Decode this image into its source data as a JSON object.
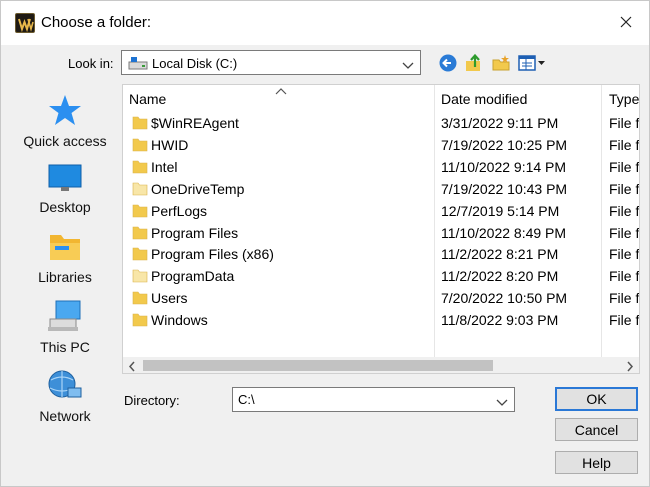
{
  "dialog": {
    "title": "Choose a folder:",
    "close_glyph": "✕"
  },
  "lookin": {
    "label": "Look in:",
    "value": "Local Disk (C:)",
    "icon": "drive-icon"
  },
  "toolbar": {
    "icons": [
      "back-icon",
      "up-folder-icon",
      "new-folder-icon",
      "view-menu-icon"
    ]
  },
  "places": [
    {
      "label": "Quick access",
      "icon": "quick-access-star-icon"
    },
    {
      "label": "Desktop",
      "icon": "desktop-icon"
    },
    {
      "label": "Libraries",
      "icon": "libraries-icon"
    },
    {
      "label": "This PC",
      "icon": "this-pc-icon"
    },
    {
      "label": "Network",
      "icon": "network-icon"
    }
  ],
  "columns": {
    "name": "Name",
    "date": "Date modified",
    "type": "Type"
  },
  "files": [
    {
      "name": "$WinREAgent",
      "date": "3/31/2022 9:11 PM",
      "type": "File folder",
      "hidden": false
    },
    {
      "name": "HWID",
      "date": "7/19/2022 10:25 PM",
      "type": "File folder",
      "hidden": false
    },
    {
      "name": "Intel",
      "date": "11/10/2022 9:14 PM",
      "type": "File folder",
      "hidden": false
    },
    {
      "name": "OneDriveTemp",
      "date": "7/19/2022 10:43 PM",
      "type": "File folder",
      "hidden": true
    },
    {
      "name": "PerfLogs",
      "date": "12/7/2019 5:14 PM",
      "type": "File folder",
      "hidden": false
    },
    {
      "name": "Program Files",
      "date": "11/10/2022 8:49 PM",
      "type": "File folder",
      "hidden": false
    },
    {
      "name": "Program Files (x86)",
      "date": "11/2/2022 8:21 PM",
      "type": "File folder",
      "hidden": false
    },
    {
      "name": "ProgramData",
      "date": "11/2/2022 8:20 PM",
      "type": "File folder",
      "hidden": true
    },
    {
      "name": "Users",
      "date": "7/20/2022 10:50 PM",
      "type": "File folder",
      "hidden": false
    },
    {
      "name": "Windows",
      "date": "11/8/2022 9:03 PM",
      "type": "File folder",
      "hidden": false
    }
  ],
  "directory": {
    "label": "Directory:",
    "value": "C:\\"
  },
  "buttons": {
    "ok": "OK",
    "cancel": "Cancel",
    "help": "Help"
  },
  "colors": {
    "folder": "#f2c94c",
    "folder_hidden": "#f8e6a8",
    "accent": "#2a78d6"
  }
}
